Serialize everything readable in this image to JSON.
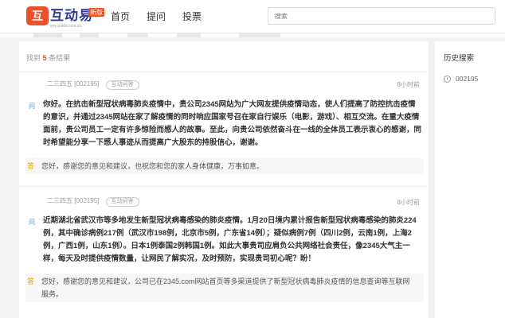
{
  "header": {
    "logo_mark": "互",
    "logo_text": "互动易",
    "logo_badge": "新版",
    "logo_sub": "irm.cninfo.com.cn",
    "nav": [
      "首页",
      "提问",
      "投票"
    ],
    "search_placeholder": "搜索"
  },
  "results": {
    "prefix": "找到",
    "count": "5",
    "suffix": "条结果"
  },
  "items": [
    {
      "company": "二三四五 [002195]",
      "tag": "互动问答",
      "time": "8小时前",
      "question_icon": "问",
      "question": "你好。在抗击新型冠状病毒肺炎疫情中，贵公司2345网站为广大网友提供疫情动态，使人们提高了防控抗击疫情的意识，并通过2345网站在家了解疫情的同时响应国家号召在家自行娱乐（电影，游戏）、相互交流。在重大疫情面前，贵公司员工一定有许多惊险而感人的故事。至此，向贵公司依然奋斗在一线的全体员工表示衷心的感谢，同时希望能分享一下感人事迹从而提高广大股东的持股信心，谢谢。",
      "answer_icon": "答",
      "answer": "您好，感谢您的意见和建议，也祝您和您的家人身体健康，万事如意。"
    },
    {
      "company": "二三四五 [002195]",
      "tag": "互动问答",
      "time": "8小时前",
      "question_icon": "问",
      "question": "近期湖北省武汉市等多地发生新型冠状病毒感染的肺炎疫情。1月20日境内累计报告新型冠状病毒感染的肺炎224例，其中确诊病例217例（武汉市198例，北京市5例，广东省14例）；疑似病例7例（四川2例，云南1例，上海2例，广西1例，山东1例）。日本1例泰国2例韩国1例。如此大事贵司应肩负公共网络社会责任，像2345大气主一样，每天及时提供疫情数量，让网民了解实况，及时预防，实现贵司初心呢？盼！",
      "answer_icon": "答",
      "answer": "您好，感谢您的意见和建议，公司已在2345.com网站首页等多渠道提供了新型冠状病毒肺炎疫情的信息查询等互联网服务。"
    }
  ],
  "sidebar": {
    "title": "历史搜索",
    "history": [
      "002195"
    ]
  }
}
